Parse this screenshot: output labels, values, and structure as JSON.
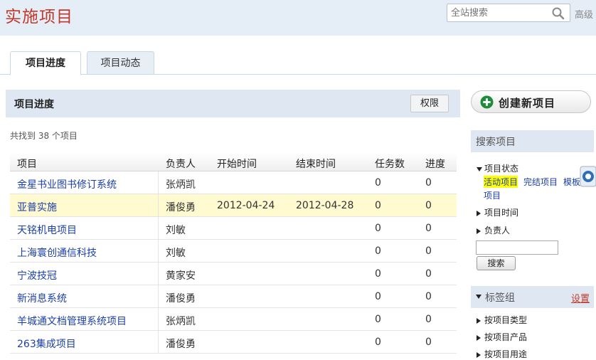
{
  "header": {
    "title": "实施项目",
    "search_placeholder": "全站搜索",
    "advanced_label": "高级"
  },
  "tabs": [
    {
      "label": "项目进度",
      "active": true
    },
    {
      "label": "项目动态",
      "active": false
    }
  ],
  "panel": {
    "title": "项目进度",
    "permission_label": "权限",
    "found_text": "共找到 38 个项目"
  },
  "table": {
    "columns": [
      "项目",
      "负责人",
      "开始时间",
      "结束时间",
      "任务数",
      "进度"
    ],
    "rows": [
      {
        "name": "金星书业图书修订系统",
        "owner": "张炳凯",
        "start": "",
        "end": "",
        "tasks": "0",
        "progress": "0"
      },
      {
        "name": "亚普实施",
        "owner": "潘俊勇",
        "start": "2012-04-24",
        "end": "2012-04-28",
        "tasks": "0",
        "progress": "0"
      },
      {
        "name": "天铭机电项目",
        "owner": "刘敏",
        "start": "",
        "end": "",
        "tasks": "0",
        "progress": "0"
      },
      {
        "name": "上海寰创通信科技",
        "owner": "刘敏",
        "start": "",
        "end": "",
        "tasks": "0",
        "progress": "0"
      },
      {
        "name": "宁波技冠",
        "owner": "黄家安",
        "start": "",
        "end": "",
        "tasks": "0",
        "progress": "0"
      },
      {
        "name": "新消息系统",
        "owner": "潘俊勇",
        "start": "",
        "end": "",
        "tasks": "0",
        "progress": "0"
      },
      {
        "name": "羊城通文档管理系统项目",
        "owner": "张炳凯",
        "start": "",
        "end": "",
        "tasks": "0",
        "progress": "0"
      },
      {
        "name": "263集成项目",
        "owner": "潘俊勇",
        "start": "",
        "end": "",
        "tasks": "0",
        "progress": "0"
      }
    ]
  },
  "sidebar": {
    "create_label": "创建新项目",
    "search_title": "搜索项目",
    "status_label": "项目状态",
    "status_active": "活动项目",
    "status_done": "完结项目",
    "status_template": "模板",
    "status_template_cont": "项目",
    "time_label": "项目时间",
    "owner_label": "负责人",
    "search_button": "搜索",
    "tags_title": "标签组",
    "tags_setting": "设置",
    "tag_items": [
      "按项目类型",
      "按项目产品",
      "按项目用途"
    ]
  },
  "colors": {
    "title_red": "#c0392b",
    "link_blue": "#1b3fa8",
    "header_bg": "#e5edf6",
    "highlight_row": "#fffad0",
    "active_status": "#ffff00",
    "create_icon_green": "#1e8c3a"
  }
}
